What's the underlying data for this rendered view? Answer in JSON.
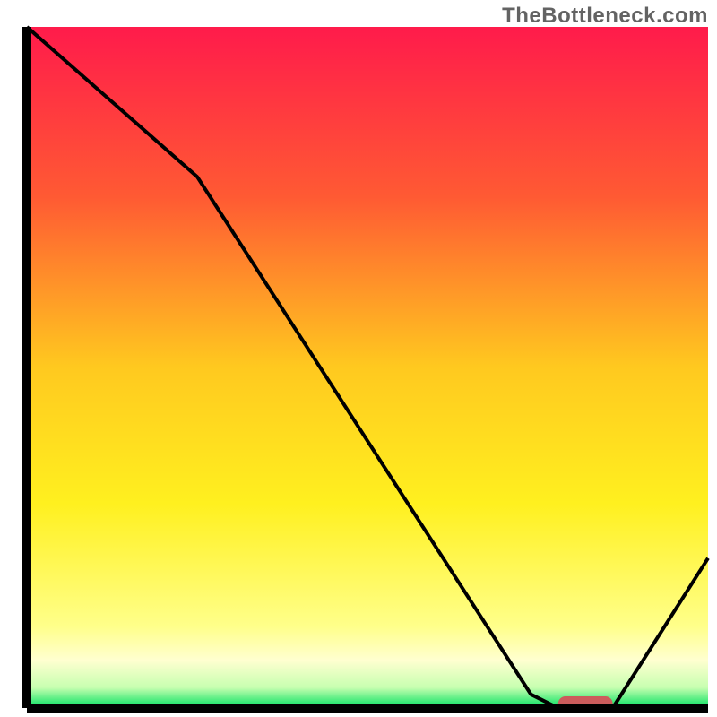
{
  "attribution": "TheBottleneck.com",
  "chart_data": {
    "type": "line",
    "title": "",
    "xlabel": "",
    "ylabel": "",
    "xlim": [
      0,
      100
    ],
    "ylim": [
      0,
      100
    ],
    "x": [
      0,
      25,
      74,
      78,
      86,
      100
    ],
    "values": [
      100,
      78,
      2,
      0,
      0,
      22
    ],
    "marker": {
      "x_start": 78,
      "x_end": 86,
      "y": 0
    },
    "background_gradient": {
      "stops": [
        {
          "offset": 0.0,
          "color": "#ff1b4b"
        },
        {
          "offset": 0.25,
          "color": "#ff5a33"
        },
        {
          "offset": 0.5,
          "color": "#ffc91f"
        },
        {
          "offset": 0.7,
          "color": "#fff01f"
        },
        {
          "offset": 0.88,
          "color": "#ffff8a"
        },
        {
          "offset": 0.93,
          "color": "#ffffd0"
        },
        {
          "offset": 0.97,
          "color": "#c7ffb0"
        },
        {
          "offset": 1.0,
          "color": "#00e060"
        }
      ]
    },
    "marker_color": "#cc5c5c",
    "curve_color": "#000000",
    "axis_color": "#000000"
  }
}
